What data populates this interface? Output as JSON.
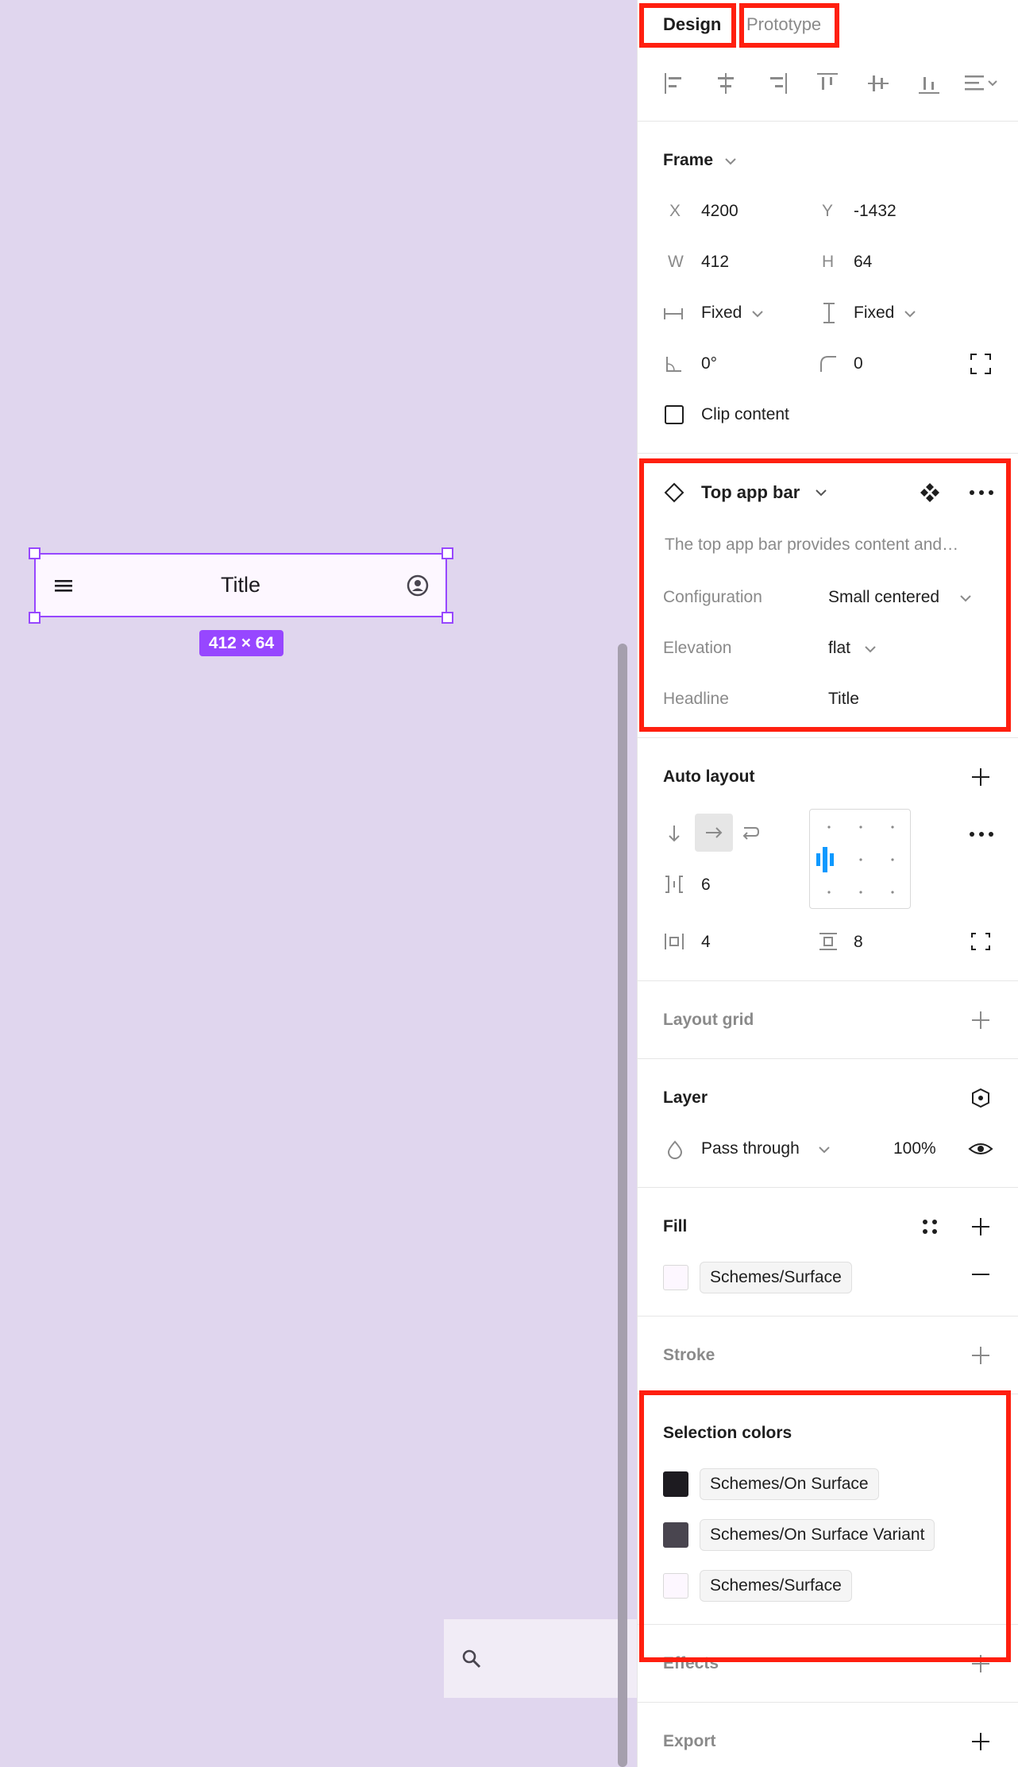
{
  "canvas": {
    "frame_title": "Title",
    "size_badge": "412 × 64",
    "icons": {
      "menu": "menu-icon",
      "account": "account-circle-icon",
      "search": "search-icon"
    }
  },
  "panel": {
    "tabs": {
      "design": "Design",
      "prototype": "Prototype"
    },
    "frame": {
      "title": "Frame",
      "x_label": "X",
      "x_value": "4200",
      "y_label": "Y",
      "y_value": "-1432",
      "w_label": "W",
      "w_value": "412",
      "h_label": "H",
      "h_value": "64",
      "h_sizing": "Fixed",
      "v_sizing": "Fixed",
      "rotation": "0°",
      "radius": "0",
      "clip_content": "Clip content"
    },
    "component": {
      "title": "Top app bar",
      "description": "The top app bar provides content and…",
      "configuration_label": "Configuration",
      "configuration_value": "Small centered",
      "elevation_label": "Elevation",
      "elevation_value": "flat",
      "headline_label": "Headline",
      "headline_value": "Title"
    },
    "auto_layout": {
      "title": "Auto layout",
      "gap": "6",
      "padding_h": "4",
      "padding_v": "8"
    },
    "layout_grid": {
      "title": "Layout grid"
    },
    "layer": {
      "title": "Layer",
      "blend": "Pass through",
      "opacity": "100%"
    },
    "fill": {
      "title": "Fill",
      "style": "Schemes/Surface",
      "color": "#fdf7ff"
    },
    "stroke": {
      "title": "Stroke"
    },
    "selection_colors": {
      "title": "Selection colors",
      "items": [
        {
          "name": "Schemes/On Surface",
          "color": "#1d1b20"
        },
        {
          "name": "Schemes/On Surface Variant",
          "color": "#49454f"
        },
        {
          "name": "Schemes/Surface",
          "color": "#fdf7ff"
        }
      ]
    },
    "effects": {
      "title": "Effects"
    },
    "export": {
      "title": "Export"
    }
  },
  "colors": {
    "highlight": "#ff1f0f",
    "selection": "#9747ff",
    "canvas": "#e0d6ee",
    "accent_blue": "#0d99ff"
  }
}
